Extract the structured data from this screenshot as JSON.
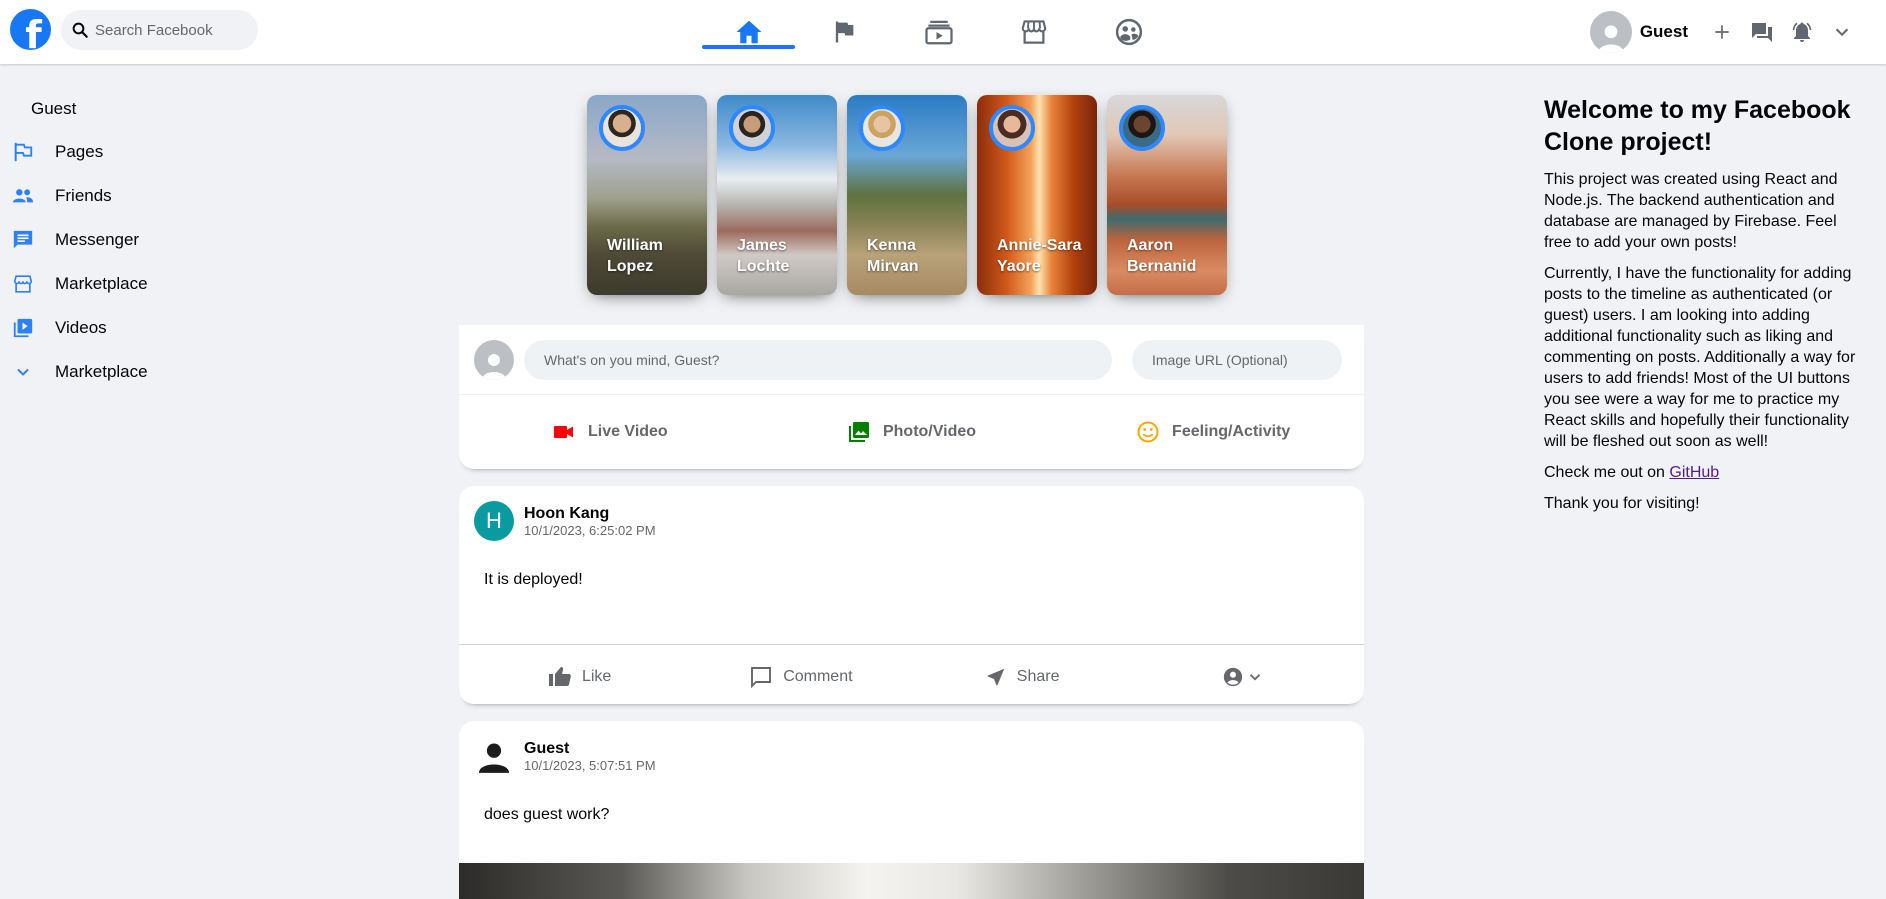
{
  "header": {
    "search_placeholder": "Search Facebook",
    "user_name": "Guest",
    "nav": [
      "home-icon",
      "flag-icon",
      "subscriptions-icon",
      "storefront-icon",
      "supervised-user-icon"
    ],
    "accent": "#1877f2"
  },
  "sidebar": {
    "user": "Guest",
    "items": [
      {
        "label": "Pages",
        "icon": "flag-icon"
      },
      {
        "label": "Friends",
        "icon": "people-icon"
      },
      {
        "label": "Messenger",
        "icon": "chat-icon"
      },
      {
        "label": "Marketplace",
        "icon": "storefront-icon"
      },
      {
        "label": "Videos",
        "icon": "video-library-icon"
      },
      {
        "label": "Marketplace",
        "icon": "expand-more-icon"
      }
    ]
  },
  "stories": [
    {
      "name": "William Lopez"
    },
    {
      "name": "James Lochte"
    },
    {
      "name": "Kenna Mirvan"
    },
    {
      "name": "Annie-Sara Yaore"
    },
    {
      "name": "Aaron Bernanid"
    }
  ],
  "composer": {
    "placeholder": "What's on you mind, Guest?",
    "url_placeholder": "Image URL (Optional)",
    "options": [
      {
        "label": "Live Video",
        "icon": "videocam-icon",
        "color": "#ff0000"
      },
      {
        "label": "Photo/Video",
        "icon": "photo-library-icon",
        "color": "#008000"
      },
      {
        "label": "Feeling/Activity",
        "icon": "mood-icon",
        "color": "#ffa500"
      }
    ]
  },
  "posts": [
    {
      "avatar_letter": "H",
      "author": "Hoon Kang",
      "timestamp": "10/1/2023, 6:25:02 PM",
      "text": "It is deployed!"
    },
    {
      "author": "Guest",
      "timestamp": "10/1/2023, 5:07:51 PM",
      "text": "does guest work?"
    }
  ],
  "post_actions": [
    "Like",
    "Comment",
    "Share"
  ],
  "widget": {
    "title": "Welcome to my Facebook Clone project!",
    "p1": "This project was created using React and Node.js. The backend authentication and database are managed by Firebase. Feel free to add your own posts!",
    "p2": "Currently, I have the functionality for adding posts to the timeline as authenticated (or guest) users. I am looking into adding additional functionality such as liking and commenting on posts. Additionally a way for users to add friends! Most of the UI buttons you see were a way for me to practice my React skills and hopefully their functionality will be fleshed out soon as well!",
    "p3_prefix": "Check me out on ",
    "p3_link": "GitHub",
    "p4": "Thank you for visiting!"
  }
}
